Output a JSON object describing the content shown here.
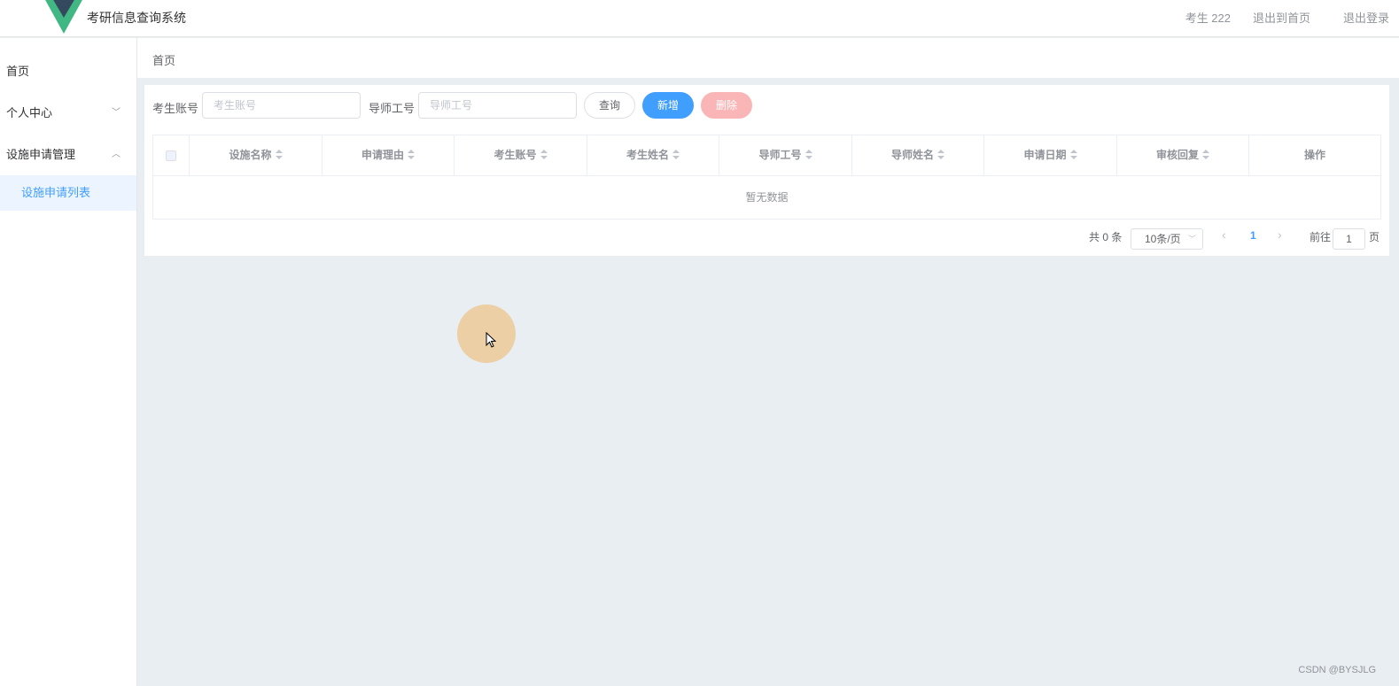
{
  "header": {
    "app_title": "考研信息查询系统",
    "user_label": "考生 222",
    "back_home": "退出到首页",
    "logout": "退出登录"
  },
  "sidebar": {
    "items": [
      {
        "label": "首页"
      },
      {
        "label": "个人中心",
        "arrow": "﹀"
      },
      {
        "label": "设施申请管理",
        "arrow": "︿"
      }
    ],
    "sub_items": [
      {
        "label": "设施申请列表"
      }
    ]
  },
  "breadcrumb": "首页",
  "search": {
    "student_label": "考生账号",
    "student_placeholder": "考生账号",
    "teacher_label": "导师工号",
    "teacher_placeholder": "导师工号",
    "query_btn": "查询",
    "add_btn": "新增",
    "delete_btn": "删除"
  },
  "table": {
    "columns": [
      "设施名称",
      "申请理由",
      "考生账号",
      "考生姓名",
      "导师工号",
      "导师姓名",
      "申请日期",
      "审核回复",
      "操作"
    ],
    "empty_text": "暂无数据"
  },
  "pagination": {
    "total_text": "共 0 条",
    "page_size": "10条/页",
    "current_page": "1",
    "goto_label": "前往",
    "goto_value": "1",
    "page_suffix": "页"
  },
  "watermark": "CSDN @BYSJLG",
  "colors": {
    "primary": "#409eff",
    "danger_light": "#fab6b6",
    "content_bg": "#e9eef3"
  }
}
